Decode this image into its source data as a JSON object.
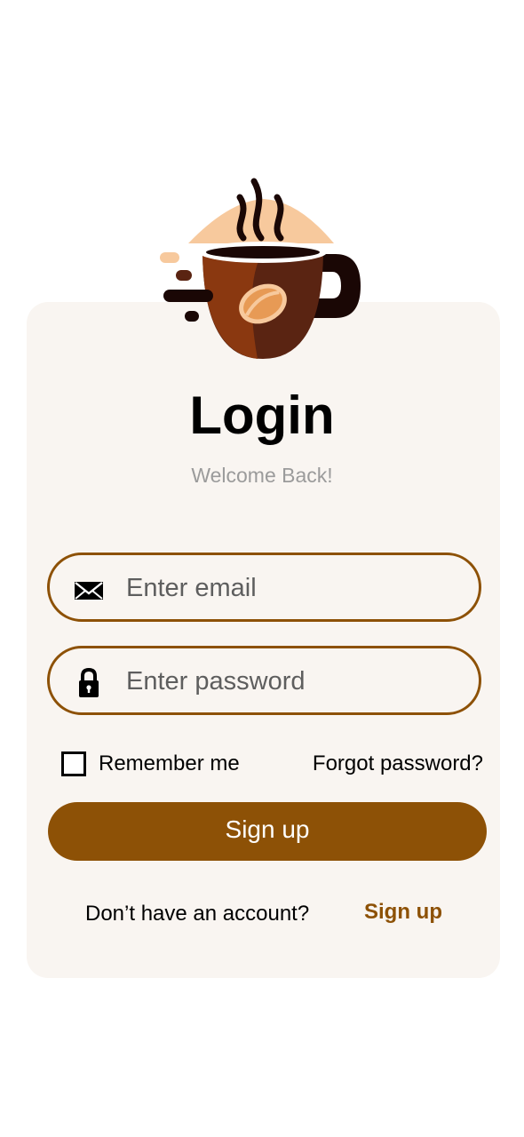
{
  "login": {
    "title": "Login",
    "subtitle": "Welcome Back!",
    "email": {
      "placeholder": "Enter email",
      "value": "",
      "icon": "envelope-icon"
    },
    "password": {
      "placeholder": "Enter password",
      "value": "",
      "icon": "lock-icon"
    },
    "remember_label": "Remember me",
    "remember_checked": false,
    "forgot_label": "Forgot password?",
    "primary_button_label": "Sign up",
    "footer_text": "Don’t have an account?",
    "footer_link": "Sign up"
  },
  "theme": {
    "accent": "#8d5106",
    "card_background": "#f9f5f1",
    "subtitle_color": "#9b9b9b"
  }
}
